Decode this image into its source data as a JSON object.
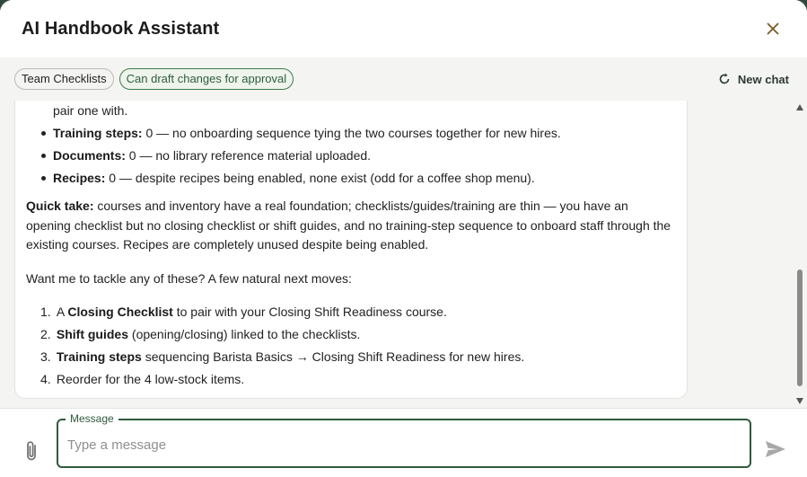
{
  "header": {
    "title": "AI Handbook Assistant",
    "close_icon": "close-icon"
  },
  "toolbar": {
    "chips": [
      {
        "label": "Team Checklists"
      },
      {
        "label": "Can draft changes for approval"
      }
    ],
    "new_chat_label": "New chat",
    "new_chat_icon": "refresh-icon"
  },
  "message": {
    "top_continuation": "pair one with.",
    "bullets": [
      {
        "bold": "Training steps:",
        "text": " 0 — no onboarding sequence tying the two courses together for new hires."
      },
      {
        "bold": "Documents:",
        "text": " 0 — no library reference material uploaded."
      },
      {
        "bold": "Recipes:",
        "text": " 0 — despite recipes being enabled, none exist (odd for a coffee shop menu)."
      }
    ],
    "quick_take_bold": "Quick take:",
    "quick_take_text": " courses and inventory have a real foundation; checklists/guides/training are thin — you have an opening checklist but no closing checklist or shift guides, and no training-step sequence to onboard staff through the existing courses. Recipes are completely unused despite being enabled.",
    "prompt": "Want me to tackle any of these? A few natural next moves:",
    "next_moves": [
      {
        "num": "1.",
        "pre": "A ",
        "bold": "Closing Checklist",
        "text": " to pair with your Closing Shift Readiness course."
      },
      {
        "num": "2.",
        "pre": "",
        "bold": "Shift guides",
        "text": " (opening/closing) linked to the checklists."
      },
      {
        "num": "3.",
        "pre": "",
        "bold": "Training steps",
        "text": " sequencing Barista Basics → Closing Shift Readiness for new hires."
      },
      {
        "num": "4.",
        "pre": "",
        "bold": "",
        "text": "Reorder for the 4 low-stock items."
      }
    ]
  },
  "composer": {
    "legend": "Message",
    "placeholder": "Type a message",
    "value": "",
    "attach_icon": "paperclip-icon",
    "send_icon": "send-icon"
  },
  "colors": {
    "accent_green": "#2f5a3c",
    "panel_bg": "#f4f5f2",
    "close_icon": "#7a5a1f"
  }
}
